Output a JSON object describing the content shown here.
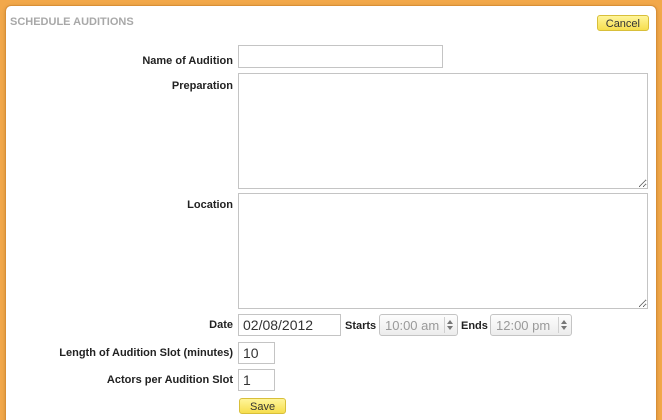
{
  "header": {
    "title": "SCHEDULE AUDITIONS",
    "cancel_label": "Cancel"
  },
  "form": {
    "name_label": "Name of Audition",
    "name_value": "",
    "preparation_label": "Preparation",
    "preparation_value": "",
    "location_label": "Location",
    "location_value": "",
    "date_label": "Date",
    "date_value": "02/08/2012",
    "starts_label": "Starts",
    "starts_value": "10:00 am",
    "ends_label": "Ends",
    "ends_value": "12:00 pm",
    "slot_length_label": "Length of Audition Slot (minutes)",
    "slot_length_value": "10",
    "actors_label": "Actors per Audition Slot",
    "actors_value": "1",
    "save_label": "Save"
  },
  "colors": {
    "background": "#f2a84a",
    "button": "#f6de4e",
    "header_text": "#a8a8a8"
  }
}
